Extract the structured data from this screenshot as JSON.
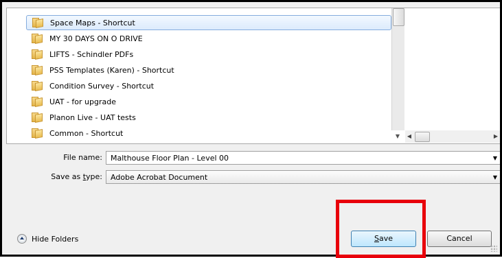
{
  "file_list": {
    "items": [
      {
        "label": "Space Maps - Shortcut",
        "selected": true
      },
      {
        "label": "MY 30 DAYS ON O DRIVE",
        "selected": false
      },
      {
        "label": "LIFTS - Schindler PDFs",
        "selected": false
      },
      {
        "label": "PSS Templates (Karen) - Shortcut",
        "selected": false
      },
      {
        "label": "Condition Survey - Shortcut",
        "selected": false
      },
      {
        "label": "UAT - for upgrade",
        "selected": false
      },
      {
        "label": "Planon Live - UAT tests",
        "selected": false
      },
      {
        "label": "Common - Shortcut",
        "selected": false
      }
    ]
  },
  "form": {
    "file_name_label": "File name:",
    "file_name_value": "Malthouse Floor Plan - Level 00",
    "save_type_label_pre": "Save as ",
    "save_type_label_accel": "t",
    "save_type_label_post": "ype:",
    "save_type_value": "Adobe Acrobat Document"
  },
  "footer": {
    "hide_folders_label": "Hide Folders",
    "save_label_accel": "S",
    "save_label_rest": "ave",
    "cancel_label": "Cancel"
  },
  "icons": {
    "dropdown": "▼",
    "scroll_down": "▼",
    "scroll_left": "◀",
    "scroll_right": "▶"
  },
  "colors": {
    "highlight": "#e8000b",
    "selection_border": "#84acdd",
    "default_button_border": "#3c7fb1"
  }
}
